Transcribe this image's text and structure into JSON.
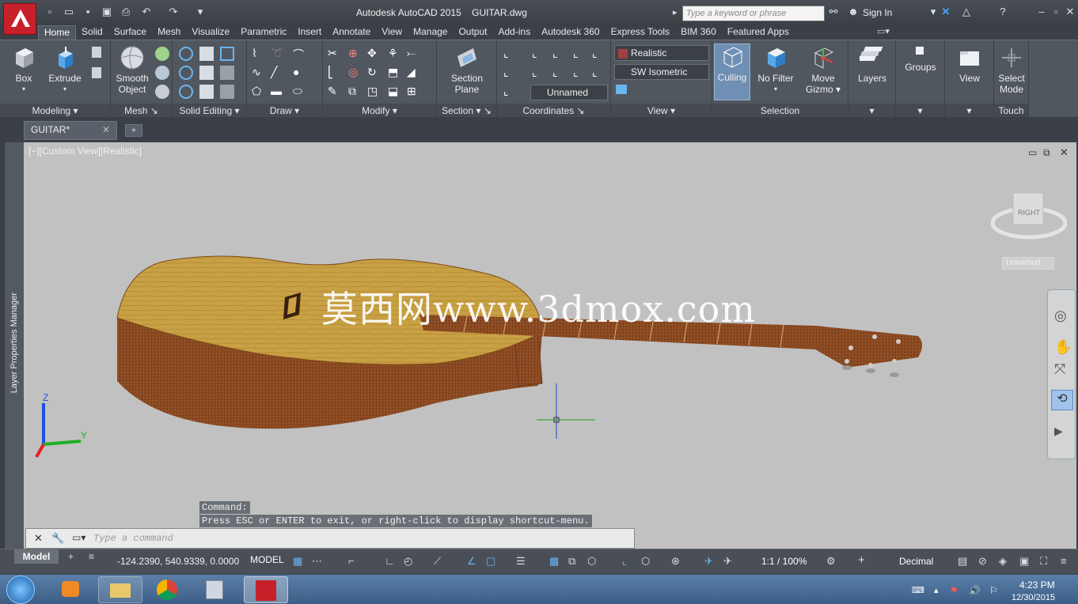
{
  "title_bar": {
    "app": "Autodesk AutoCAD 2015",
    "file": "GUITAR.dwg",
    "search_placeholder": "Type a keyword or phrase",
    "sign_in": "Sign In"
  },
  "tabs": [
    "Home",
    "Solid",
    "Surface",
    "Mesh",
    "Visualize",
    "Parametric",
    "Insert",
    "Annotate",
    "View",
    "Manage",
    "Output",
    "Add-ins",
    "Autodesk 360",
    "Express Tools",
    "BIM 360",
    "Featured Apps"
  ],
  "ribbon": {
    "modeling": {
      "title": "Modeling",
      "box": "Box",
      "extrude": "Extrude"
    },
    "mesh": {
      "title": "Mesh",
      "smooth1": "Smooth",
      "smooth2": "Object"
    },
    "solid_editing": {
      "title": "Solid Editing"
    },
    "draw": {
      "title": "Draw"
    },
    "modify": {
      "title": "Modify"
    },
    "section": {
      "title": "Section",
      "plane1": "Section",
      "plane2": "Plane"
    },
    "coordinates": {
      "title": "Coordinates",
      "ucs": "Unnamed"
    },
    "view": {
      "title": "View",
      "visual_style": "Realistic",
      "view_preset": "SW Isometric"
    },
    "selection": {
      "title": "Selection",
      "culling": "Culling",
      "nofilter": "No Filter",
      "gizmo1": "Move",
      "gizmo2": "Gizmo"
    },
    "layers": "Layers",
    "groups": "Groups",
    "view_btn": "View",
    "touch": {
      "title": "Touch",
      "select1": "Select",
      "select2": "Mode"
    }
  },
  "file_tab": "GUITAR*",
  "viewport": {
    "label": "[−][Custom View][Realistic]",
    "viewcube_face": "RIGHT",
    "viewcube_ucs": "Unnamed",
    "watermark": "莫西网www.3dmox.com"
  },
  "side_palette": "Layer Properties Manager",
  "command": {
    "history1": "Command:",
    "history2": "Press ESC or ENTER to exit, or right-click to display shortcut-menu.",
    "placeholder": "Type a command"
  },
  "status": {
    "model_tab": "Model",
    "coords": "-124.2390, 540.9339, 0.0000",
    "model": "MODEL",
    "scale": "1:1 / 100%",
    "units": "Decimal"
  },
  "taskbar": {
    "time": "4:23 PM",
    "date": "12/30/2015"
  },
  "colors": {
    "accent": "#c8202a",
    "ribbon": "#51575f",
    "viewport": "#c1c1c1"
  }
}
